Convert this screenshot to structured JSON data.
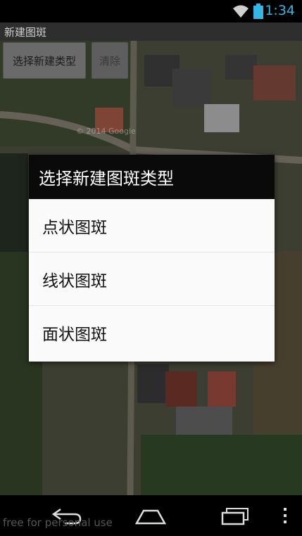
{
  "status_bar": {
    "time": "1:34",
    "icons": [
      "wifi-icon",
      "battery-icon"
    ],
    "accent_color": "#33b5e5"
  },
  "app": {
    "title": "新建图斑"
  },
  "toolbar": {
    "select_label": "选择新建类型",
    "clear_label": "清除"
  },
  "map": {
    "watermark": "© 2014 Google"
  },
  "dialog": {
    "title": "选择新建图斑类型",
    "items": [
      {
        "label": "点状图斑"
      },
      {
        "label": "线状图斑"
      },
      {
        "label": "面状图斑"
      }
    ]
  },
  "nav_bar": {
    "icons": [
      "back-icon",
      "home-icon",
      "recents-icon",
      "menu-icon"
    ]
  },
  "footer": {
    "text": "free for personal use"
  }
}
